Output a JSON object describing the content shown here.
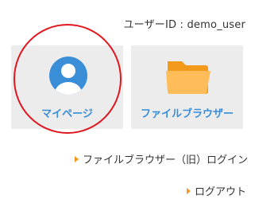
{
  "header": {
    "user_id_label": "ユーザーID : demo_user"
  },
  "tiles": [
    {
      "label": "マイページ",
      "icon": "user-avatar-icon"
    },
    {
      "label": "ファイルブラウザー",
      "icon": "folder-icon"
    }
  ],
  "links": {
    "legacy_login": "ファイルブラウザー（旧）ログイン",
    "logout": "ログアウト"
  },
  "colors": {
    "tile_label": "#3a8ed8",
    "avatar_blue": "#3a8ed8",
    "folder_orange": "#f7a21b",
    "highlight_ring": "#e0161e",
    "link_arrow": "#f39a1c"
  }
}
